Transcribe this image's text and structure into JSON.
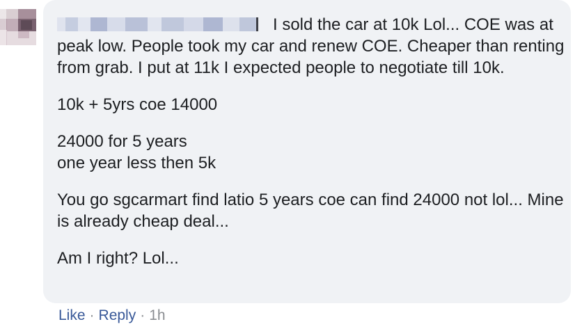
{
  "comment": {
    "author_blurred": true,
    "paragraphs": [
      "I sold the car at 10k Lol... COE was at peak low. People took my car and renew COE. Cheaper than renting from grab. I put at 11k I expected people to negotiate till 10k.",
      "10k + 5yrs coe 14000",
      "24000 for 5 years",
      "one year less then 5k",
      "You go sgcarmart find latio 5 years coe can find 24000 not lol... Mine is already cheap deal...",
      "Am I right? Lol..."
    ]
  },
  "actions": {
    "like": "Like",
    "reply": "Reply",
    "separator": "·",
    "time": "1h"
  },
  "colors": {
    "bubble": "#f0f2f5",
    "text": "#1c1e21",
    "link": "#385898",
    "meta": "#8a8d91"
  }
}
